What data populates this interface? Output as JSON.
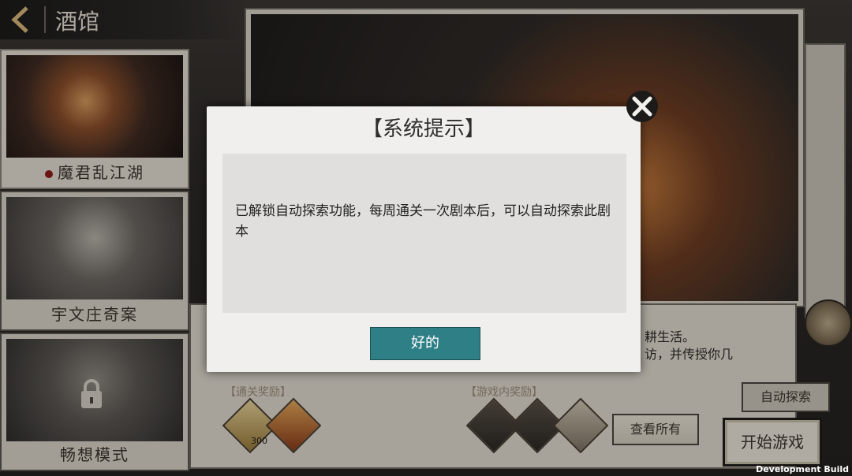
{
  "header": {
    "title": "酒馆"
  },
  "scripts": [
    {
      "label": "魔君乱江湖",
      "active": true
    },
    {
      "label": "宇文庄奇案",
      "active": false
    },
    {
      "label": "畅想模式",
      "active": false,
      "locked": true
    }
  ],
  "details": {
    "desc_line1": "耕生活。",
    "desc_line2": "访，并传授你几",
    "clear_rewards_label": "【通关奖励】",
    "ingame_rewards_label": "【游戏内奖励】",
    "reward_count": "300",
    "auto_explore_label": "自动探索",
    "view_all_label": "查看所有",
    "start_label": "开始游戏"
  },
  "modal": {
    "title": "【系统提示】",
    "message": "已解锁自动探索功能，每周通关一次剧本后，可以自动探索此剧本",
    "ok_label": "好的"
  },
  "footer": {
    "build_label": "Development Build"
  },
  "colors": {
    "accent_teal": "#2f7f87",
    "paper": "#dfd9ce"
  }
}
